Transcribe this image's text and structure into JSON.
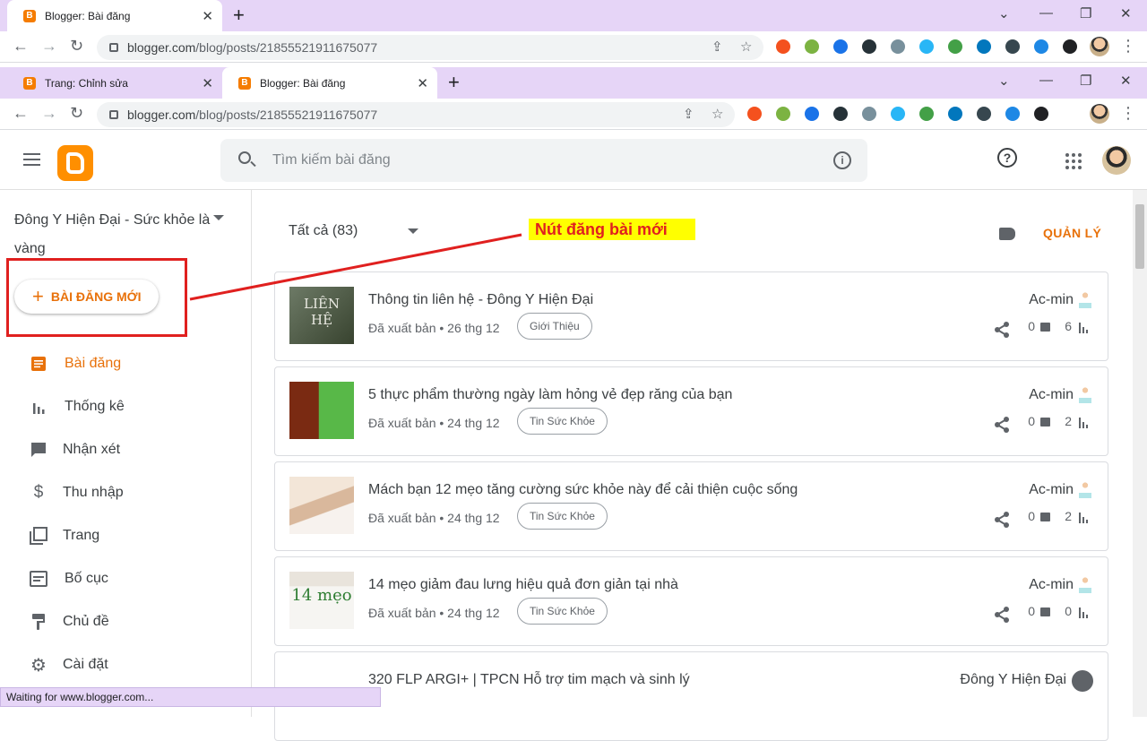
{
  "browser": {
    "window1": {
      "tab_title": "Blogger: Bài đăng",
      "url_host": "blogger.com",
      "url_path": "/blog/posts/21855521911675077"
    },
    "window2": {
      "tabs": [
        "Trang: Chỉnh sửa",
        "Blogger: Bài đăng"
      ],
      "url_host": "blogger.com",
      "url_path": "/blog/posts/21855521911675077"
    },
    "ext_colors": [
      "#f4511e",
      "#7cb342",
      "#1a73e8",
      "#263238",
      "#78909c",
      "#29b6f6",
      "#43a047",
      "#0277bd",
      "#37474f",
      "#1e88e5",
      "#202124"
    ]
  },
  "header": {
    "search_placeholder": "Tìm kiếm bài đăng"
  },
  "sidebar": {
    "blog_name": "Đông Y Hiện Đại - Sức khỏe là vàng",
    "new_post_label": "BÀI ĐĂNG MỚI",
    "items": [
      {
        "label": "Bài đăng",
        "icon": "posts-icon",
        "active": true
      },
      {
        "label": "Thống kê",
        "icon": "stats-icon"
      },
      {
        "label": "Nhận xét",
        "icon": "comments-icon"
      },
      {
        "label": "Thu nhập",
        "icon": "dollar-icon"
      },
      {
        "label": "Trang",
        "icon": "pages-icon"
      },
      {
        "label": "Bố cục",
        "icon": "layout-icon"
      },
      {
        "label": "Chủ đề",
        "icon": "theme-icon"
      },
      {
        "label": "Cài đặt",
        "icon": "gear-icon"
      }
    ]
  },
  "main": {
    "filter_label": "Tất cả (83)",
    "manage_label": "QUẢN LÝ",
    "annotation": "Nút đăng bài mới",
    "posts": [
      {
        "title": "Thông tin liên hệ - Đông Y Hiện Đại",
        "meta": "Đã xuất bản • 26 thg 12",
        "label": "Giới Thiệu",
        "author": "Ac-min",
        "comments": "0",
        "views": "6"
      },
      {
        "title": "5 thực phẩm thường ngày làm hỏng vẻ đẹp răng của bạn",
        "meta": "Đã xuất bản • 24 thg 12",
        "label": "Tin Sức Khỏe",
        "author": "Ac-min",
        "comments": "0",
        "views": "2"
      },
      {
        "title": "Mách bạn 12 mẹo tăng cường sức khỏe này để cải thiện cuộc sống",
        "meta": "Đã xuất bản • 24 thg 12",
        "label": "Tin Sức Khỏe",
        "author": "Ac-min",
        "comments": "0",
        "views": "2"
      },
      {
        "title": "14 mẹo giảm đau lưng hiệu quả đơn giản tại nhà",
        "meta": "Đã xuất bản • 24 thg 12",
        "label": "Tin Sức Khỏe",
        "author": "Ac-min",
        "comments": "0",
        "views": "0"
      },
      {
        "title": "320 FLP ARGI+ | TPCN Hỗ trợ tim mạch và sinh lý",
        "meta": "",
        "label": "",
        "author": "Đông Y Hiện Đại",
        "comments": "",
        "views": ""
      }
    ]
  },
  "status": "Waiting for www.blogger.com..."
}
